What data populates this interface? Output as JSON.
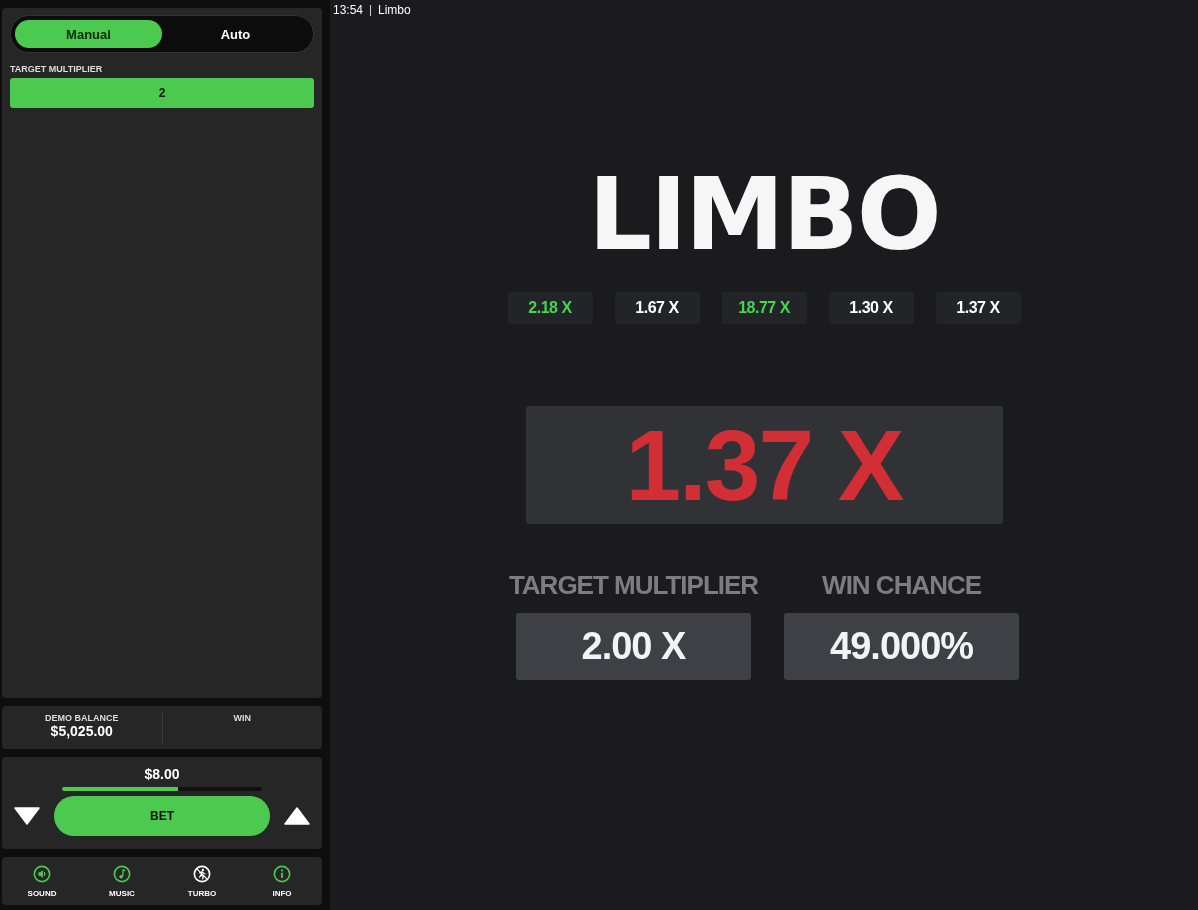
{
  "mode_tabs": [
    {
      "label": "Manual",
      "selected": true
    },
    {
      "label": "Auto",
      "selected": false
    }
  ],
  "target_input": {
    "label": "TARGET MULTIPLIER",
    "value": "2"
  },
  "balance": {
    "label": "DEMO BALANCE",
    "value": "$5,025.00",
    "win_label": "WIN"
  },
  "bet": {
    "amount": "$8.00",
    "level": 0.58,
    "button": "BET"
  },
  "footer": [
    {
      "kind": "sound",
      "label": "SOUND",
      "on": true
    },
    {
      "kind": "music",
      "label": "MUSIC",
      "on": true
    },
    {
      "kind": "turbo",
      "label": "TURBO",
      "on": false
    },
    {
      "kind": "info",
      "label": "INFO",
      "on": true
    }
  ],
  "header": {
    "time": "13:54",
    "title": "Limbo"
  },
  "logo": "LIMBO",
  "history": [
    {
      "value": "2.18 X",
      "won": true
    },
    {
      "value": "1.67 X",
      "won": false
    },
    {
      "value": "18.77 X",
      "won": true
    },
    {
      "value": "1.30 X",
      "won": false
    },
    {
      "value": "1.37 X",
      "won": false
    }
  ],
  "result": {
    "value": "1.37 X",
    "won": false
  },
  "stats": [
    {
      "label": "TARGET MULTIPLIER",
      "value": "2.00 X"
    },
    {
      "label": "WIN CHANCE",
      "value": "49.000%"
    }
  ]
}
